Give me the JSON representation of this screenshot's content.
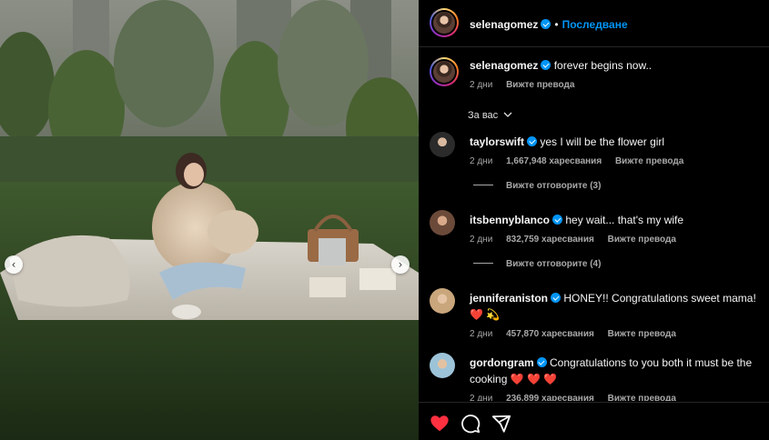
{
  "carousel": {
    "prev_glyph": "‹",
    "next_glyph": "›"
  },
  "post": {
    "author": "selenagomez",
    "follow_label": "Последване",
    "separator": "•",
    "caption": "forever begins now..",
    "age": "2 дни",
    "translate_label": "Вижте превода"
  },
  "filter": {
    "label": "За вас",
    "icon": "chevron-down-icon"
  },
  "comments": [
    {
      "username": "taylorswift",
      "text": "yes I will be the flower girl",
      "age": "2 дни",
      "likes": "1,667,948 харесвания",
      "translate": "Вижте превода",
      "replies": "Вижте отговорите (3)"
    },
    {
      "username": "itsbennyblanco",
      "text": "hey wait... that's my wife",
      "age": "2 дни",
      "likes": "832,759 харесвания",
      "translate": "Вижте превода",
      "replies": "Вижте отговорите (4)"
    },
    {
      "username": "jenniferaniston",
      "text": "HONEY!! Congratulations sweet mama! ❤️ 💫",
      "age": "2 дни",
      "likes": "457,870 харесвания",
      "translate": "Вижте превода"
    },
    {
      "username": "gordongram",
      "text": "Congratulations to you both it must be the cooking ❤️ ❤️ ❤️",
      "age": "2 дни",
      "likes": "236,899 харесвания",
      "translate": "Вижте превода"
    }
  ],
  "actions": [
    "heart-icon",
    "comment-icon",
    "share-icon"
  ],
  "colors": {
    "accent": "#0095f6",
    "liked": "#ff3040",
    "muted": "#a8a8a8",
    "bg": "#000000"
  }
}
